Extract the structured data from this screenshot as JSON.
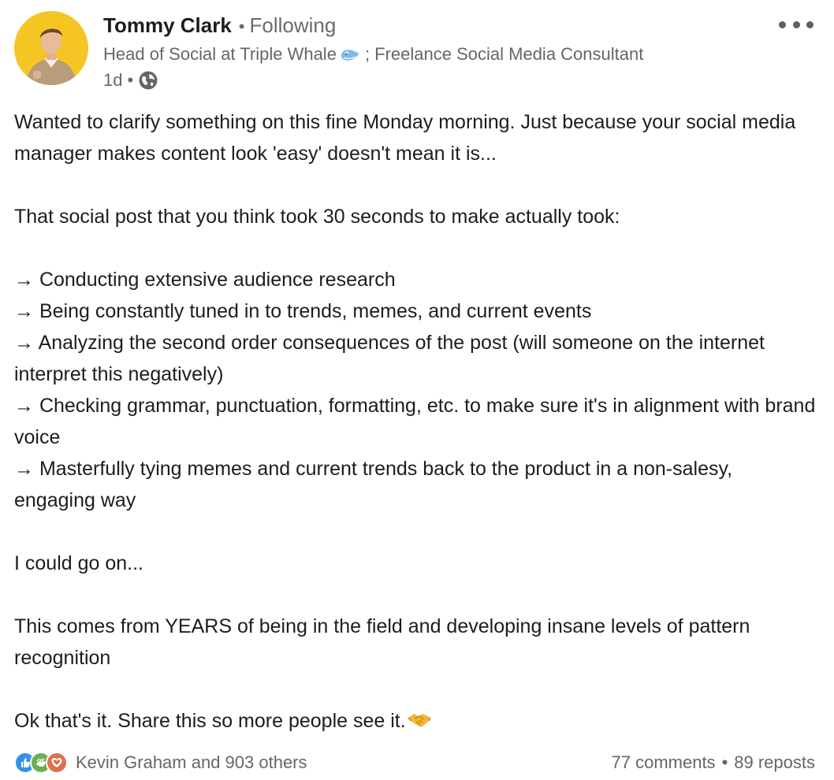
{
  "author": {
    "name": "Tommy Clark",
    "follow_status": "Following",
    "separator": "•",
    "headline_part1": "Head of Social at Triple Whale",
    "headline_part2": "; Freelance Social Media Consultant",
    "time_ago": "1d",
    "meta_separator": "•"
  },
  "icons": {
    "avatar": "profile-photo",
    "headline_emoji": "whale-icon",
    "visibility": "globe-icon",
    "menu": "more-options-icon",
    "closing_emoji": "handshake-icon",
    "reactions": [
      "like-reaction-icon",
      "support-reaction-icon",
      "love-reaction-icon"
    ]
  },
  "post": {
    "paragraphs": [
      "Wanted to clarify something on this fine Monday morning. Just because your social media manager makes content look 'easy' doesn't mean it is...",
      "",
      "That social post that you think took 30 seconds to make actually took:",
      "",
      "→ Conducting extensive audience research",
      "→ Being constantly tuned in to trends, memes, and current events",
      "→ Analyzing the second order consequences of the post (will someone on the internet interpret this negatively)",
      "→ Checking grammar, punctuation, formatting, etc. to make sure it's in alignment with brand voice",
      "→ Masterfully tying memes and current trends back to the product in a non-salesy, engaging way",
      "",
      "I could go on...",
      "",
      "This comes from YEARS of being in the field and developing insane levels of pattern recognition",
      "",
      "Ok that's it. Share this so more people see it."
    ]
  },
  "social": {
    "reactions_text": "Kevin Graham and 903 others",
    "comments_text": "77 comments",
    "stats_separator": "•",
    "reposts_text": "89 reposts"
  },
  "colors": {
    "text_primary": "#1d1d1d",
    "text_secondary": "#666666",
    "avatar_bg": "#f5c623",
    "like_blue": "#378fe9",
    "support_green": "#6dae4f",
    "love_red": "#df704d"
  }
}
